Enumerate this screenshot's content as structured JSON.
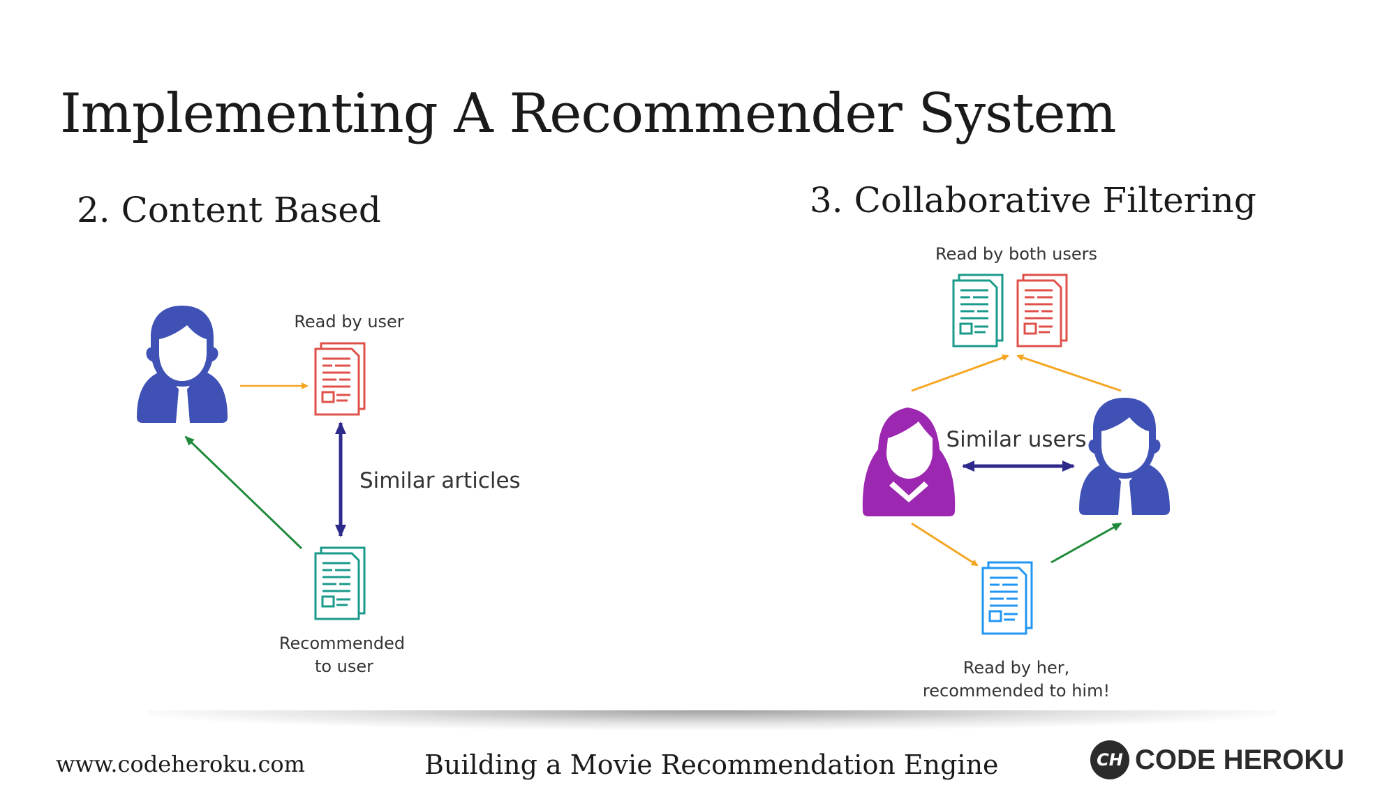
{
  "slide": {
    "title": "Implementing A Recommender System",
    "left_heading": "2. Content Based",
    "right_heading": "3. Collaborative Filtering"
  },
  "content_based": {
    "read_label": "Read by user",
    "similar_label": "Similar articles",
    "recommended_line1": "Recommended",
    "recommended_line2": "to user"
  },
  "collaborative": {
    "both_label": "Read by both users",
    "similar_label": "Similar users",
    "read_line1": "Read by her,",
    "read_line2": "recommended to him!"
  },
  "footer": {
    "url": "www.codeheroku.com",
    "title": "Building a Movie Recommendation Engine",
    "brand_logo": "CH",
    "brand": "CODE HEROKU"
  },
  "colors": {
    "male_user": "#3f51b5",
    "female_user": "#9c27b0",
    "doc_red": "#e0504a",
    "doc_teal": "#1a9a8a",
    "doc_blue": "#2196f3",
    "arrow_orange": "#f5a623",
    "arrow_green": "#1f8a3a",
    "arrow_indigo": "#2e2a8c"
  }
}
